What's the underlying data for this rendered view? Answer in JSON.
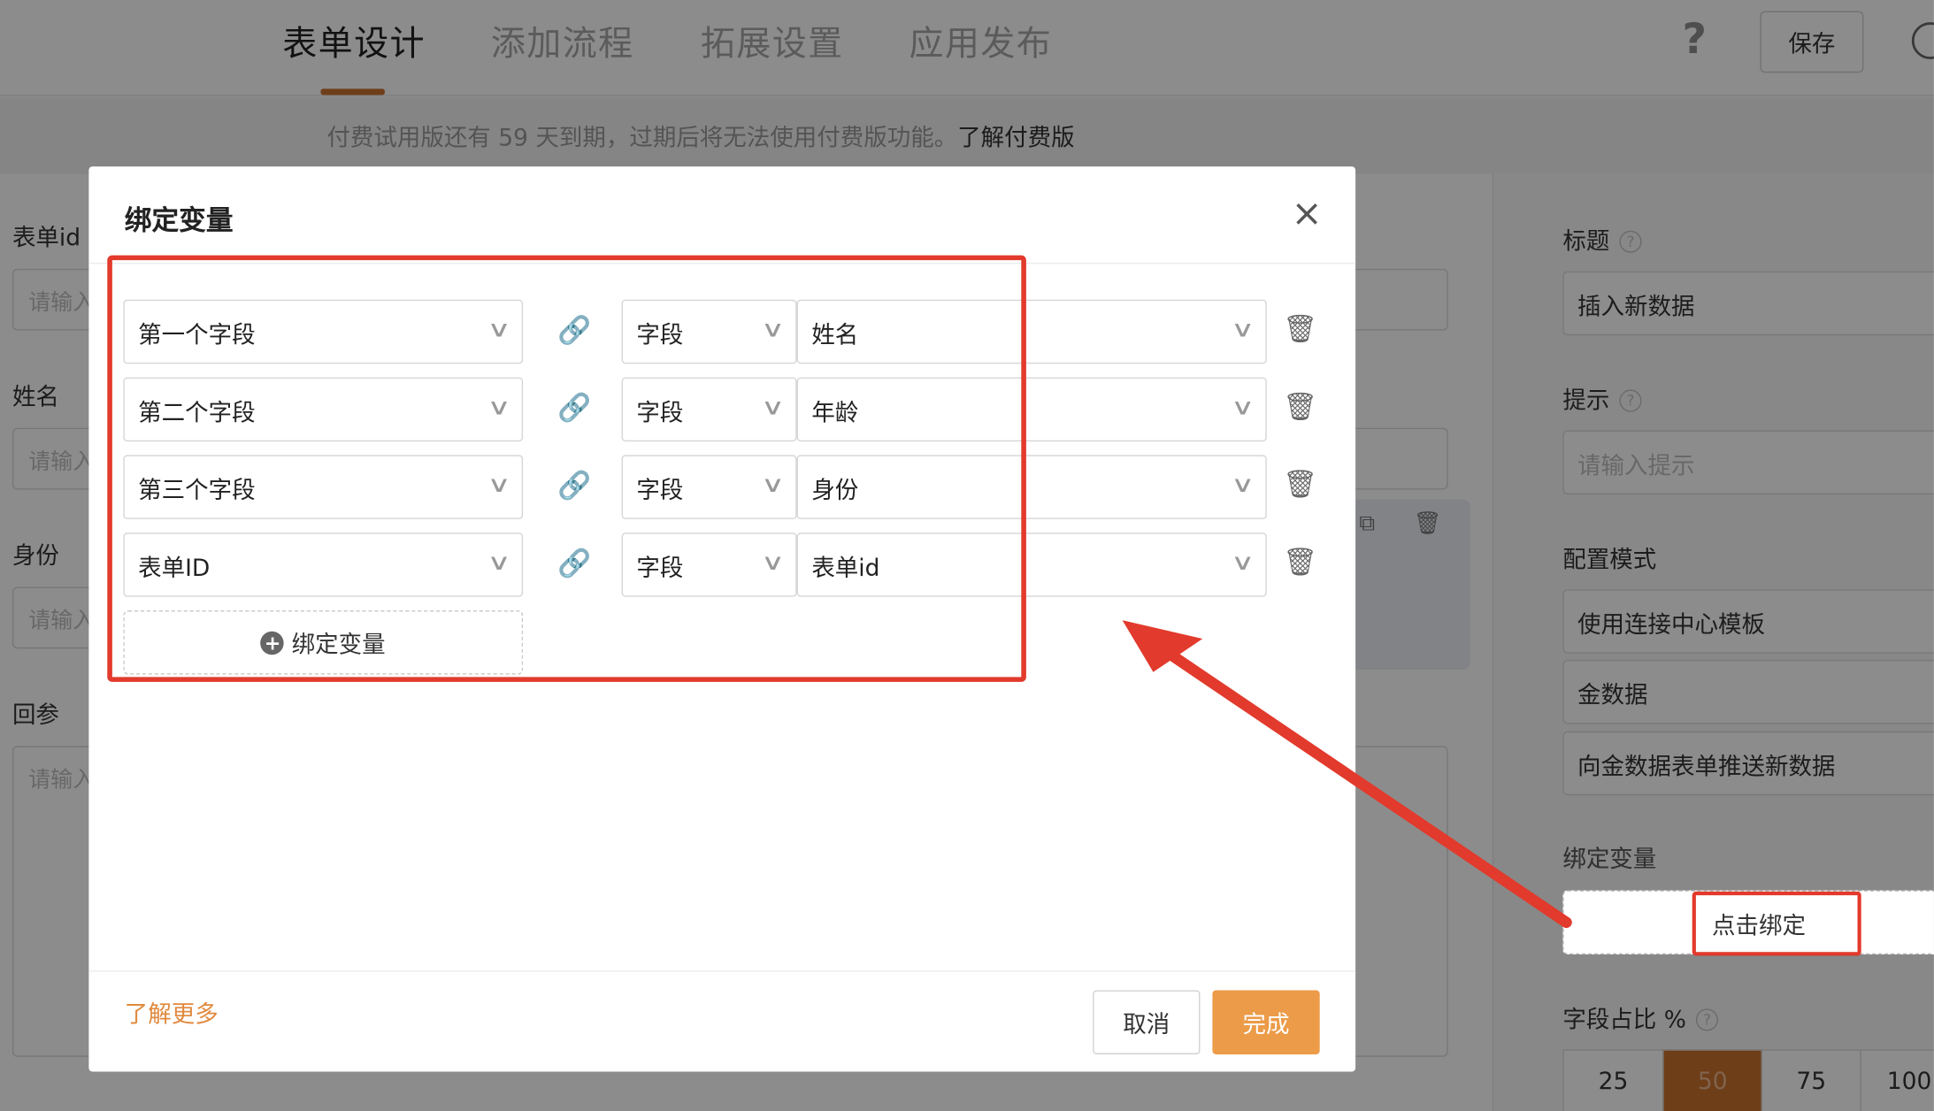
{
  "header": {
    "tabs": [
      {
        "label": "表单设计",
        "active": true
      },
      {
        "label": "添加流程",
        "active": false
      },
      {
        "label": "拓展设置",
        "active": false
      },
      {
        "label": "应用发布",
        "active": false
      }
    ],
    "help_icon": "?",
    "save_label": "保存"
  },
  "banner": {
    "text": "付费试用版还有 59 天到期，过期后将无法使用付费版功能。",
    "link": "了解付费版"
  },
  "form": {
    "fields": [
      {
        "label": "表单id",
        "placeholder": "请输入"
      },
      {
        "label": "姓名",
        "placeholder": "请输入"
      },
      {
        "label": "身份",
        "placeholder": "请输入"
      },
      {
        "label": "回参",
        "placeholder": "请输入"
      }
    ]
  },
  "right_panel": {
    "title_label": "标题",
    "title_value": "插入新数据",
    "hint_label": "提示",
    "hint_placeholder": "请输入提示",
    "config_label": "配置模式",
    "config_options": [
      "使用连接中心模板",
      "金数据",
      "向金数据表单推送新数据"
    ],
    "bind_label": "绑定变量",
    "bind_button": "点击绑定",
    "ratio_label": "字段占比 %",
    "ratio_options": [
      "25",
      "50",
      "75",
      "100"
    ],
    "ratio_selected": "50"
  },
  "modal": {
    "title": "绑定变量",
    "close_icon": "×",
    "rows": [
      {
        "source": "第一个字段",
        "type": "字段",
        "target": "姓名"
      },
      {
        "source": "第二个字段",
        "type": "字段",
        "target": "年龄"
      },
      {
        "source": "第三个字段",
        "type": "字段",
        "target": "身份"
      },
      {
        "source": "表单ID",
        "type": "字段",
        "target": "表单id"
      }
    ],
    "add_label": "绑定变量",
    "learn_more": "了解更多",
    "cancel_label": "取消",
    "done_label": "完成"
  },
  "colors": {
    "accent": "#c9712e",
    "primary_button": "#ec9b48",
    "annotation": "#e23a2c"
  }
}
